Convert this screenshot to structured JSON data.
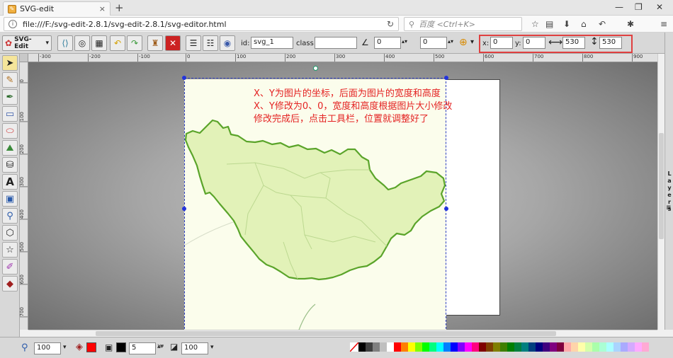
{
  "browser": {
    "tab_title": "SVG-edit",
    "tab_close": "×",
    "new_tab": "+",
    "url": "file:///F:/svg-edit-2.8.1/svg-edit-2.8.1/svg-editor.html",
    "search_placeholder": "百度 <Ctrl+K>",
    "win_min": "—",
    "win_max": "❐",
    "win_close": "✕"
  },
  "toolbar": {
    "logo_label": "SVG-Edit",
    "id_label": "id:",
    "id_value": "svg_1",
    "class_label": "class:",
    "class_value": "",
    "angle_value": "0",
    "blur_value": "0",
    "x_label": "x:",
    "x_value": "0",
    "y_label": "y:",
    "y_value": "0",
    "width_value": "530",
    "height_value": "530"
  },
  "ruler_x": [
    "-300",
    "-200",
    "-100",
    "0",
    "100",
    "200",
    "300",
    "400",
    "500",
    "600",
    "700",
    "800",
    "900"
  ],
  "ruler_y": [
    "0",
    "100",
    "200",
    "300",
    "400",
    "500",
    "600",
    "700"
  ],
  "annotation": {
    "line1": "X、Y为图片的坐标，后面为图片的宽度和高度",
    "line2": "X、Y修改为0、0，宽度和高度根据图片大小修改",
    "line3": "修改完成后，点击工具栏，位置就调整好了"
  },
  "layers_label": "L a y e r s",
  "bottom": {
    "zoom_value": "100",
    "stroke_width_value": "5",
    "stroke_arrow": "≫",
    "opacity_value": "100"
  },
  "colors": {
    "fill": "#000000",
    "stroke": "#ff0000",
    "annotation": "#e42222",
    "map_fill": "#e2f2b8",
    "map_stroke": "#5aa42a",
    "selection": "#2233dd"
  },
  "palette": [
    "#000000",
    "#3f3f3f",
    "#7f7f7f",
    "#bfbfbf",
    "#ffffff",
    "#ff0000",
    "#ff7f00",
    "#ffff00",
    "#7fff00",
    "#00ff00",
    "#00ff7f",
    "#00ffff",
    "#007fff",
    "#0000ff",
    "#7f00ff",
    "#ff00ff",
    "#ff007f",
    "#7f0000",
    "#7f3f00",
    "#7f7f00",
    "#3f7f00",
    "#007f00",
    "#007f3f",
    "#007f7f",
    "#003f7f",
    "#00007f",
    "#3f007f",
    "#7f007f",
    "#7f003f",
    "#ffaaaa",
    "#ffd4aa",
    "#ffffaa",
    "#d4ffaa",
    "#aaffaa",
    "#aaffd4",
    "#aaffff",
    "#aad4ff",
    "#aaaaff",
    "#d4aaff",
    "#ffaaff",
    "#ffaad4"
  ]
}
